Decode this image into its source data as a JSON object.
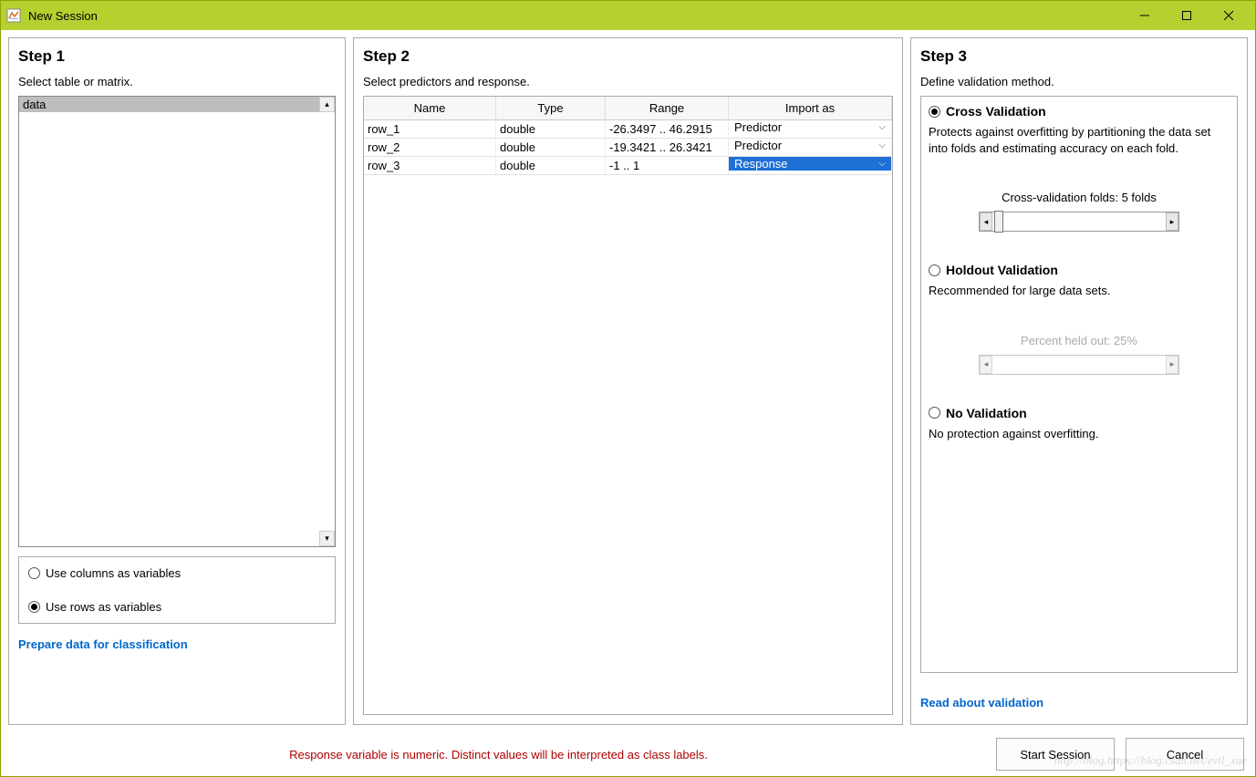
{
  "window": {
    "title": "New Session"
  },
  "step1": {
    "title": "Step 1",
    "subtitle": "Select table or matrix.",
    "items": [
      "data"
    ],
    "radio_columns": "Use columns as variables",
    "radio_rows": "Use rows as variables",
    "radio_selected": "rows",
    "link": "Prepare data for classification"
  },
  "step2": {
    "title": "Step 2",
    "subtitle": "Select predictors and response.",
    "columns": {
      "name": "Name",
      "type": "Type",
      "range": "Range",
      "import": "Import as"
    },
    "rows": [
      {
        "name": "row_1",
        "type": "double",
        "range": "-26.3497 .. 46.2915",
        "import": "Predictor",
        "selected": false
      },
      {
        "name": "row_2",
        "type": "double",
        "range": "-19.3421 .. 26.3421",
        "import": "Predictor",
        "selected": false
      },
      {
        "name": "row_3",
        "type": "double",
        "range": "-1 .. 1",
        "import": "Response",
        "selected": true
      }
    ]
  },
  "step3": {
    "title": "Step 3",
    "subtitle": "Define validation method.",
    "cross": {
      "label": "Cross Validation",
      "desc": "Protects against overfitting by partitioning the data set into folds and estimating accuracy on each fold.",
      "slider_label": "Cross-validation folds: 5 folds"
    },
    "holdout": {
      "label": "Holdout Validation",
      "desc": "Recommended for large data sets.",
      "slider_label": "Percent held out: 25%"
    },
    "none": {
      "label": "No Validation",
      "desc": "No protection against overfitting."
    },
    "selected": "cross",
    "link": "Read about validation"
  },
  "footer": {
    "message": "Response variable is numeric. Distinct values will be interpreted as class labels.",
    "start": "Start Session",
    "cancel": "Cancel"
  },
  "watermark": "http://blog.https://blog.csdn.net/evil_xue"
}
